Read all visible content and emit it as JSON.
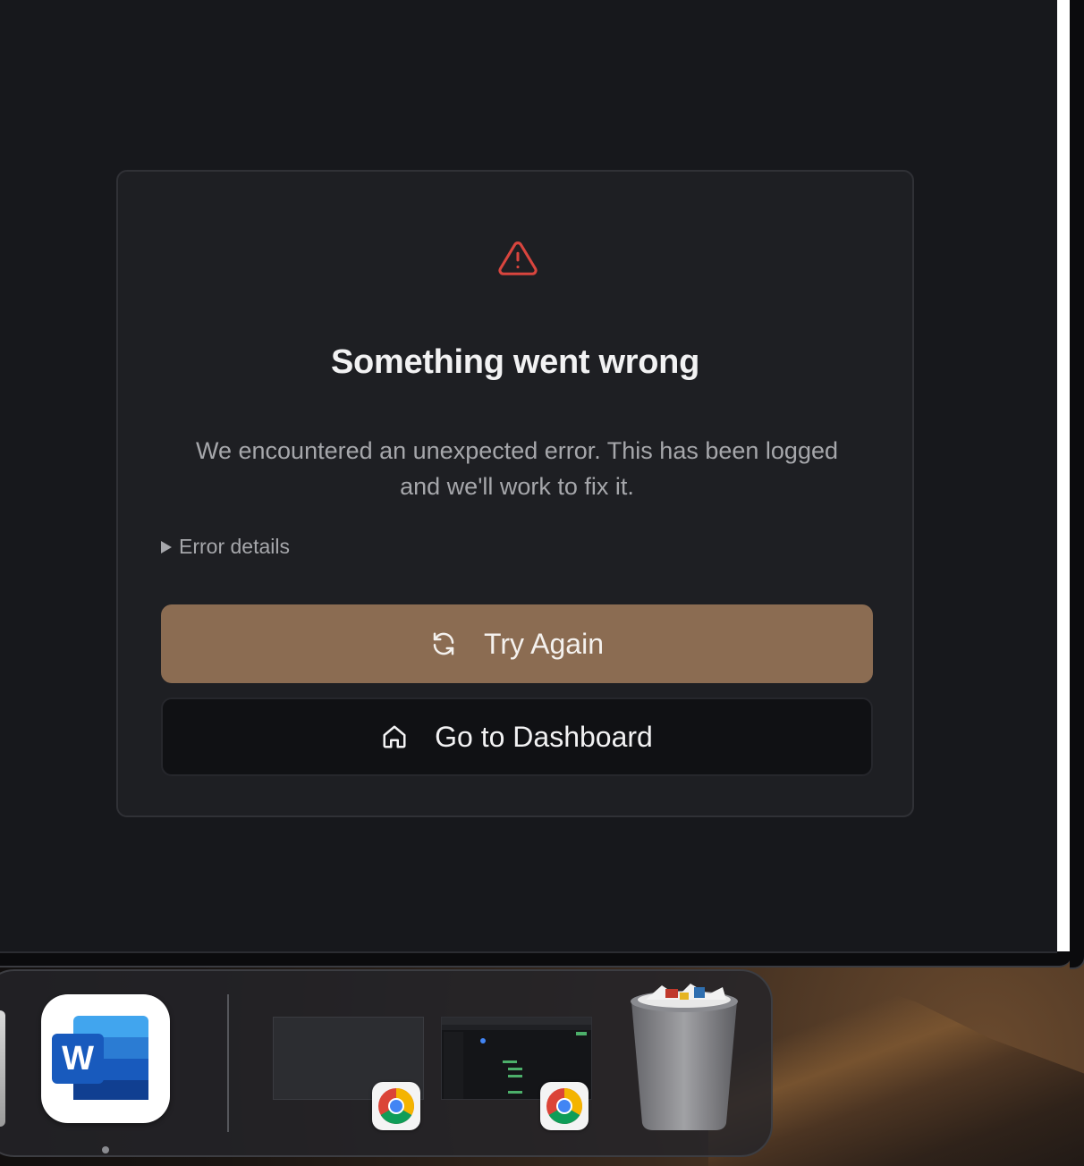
{
  "error_card": {
    "title": "Something went wrong",
    "message": "We encountered an unexpected error. This has been logged and we'll work to fix it.",
    "details_label": "Error details",
    "try_again_label": "Try Again",
    "dashboard_label": "Go to Dashboard",
    "icon": "warning-triangle-icon"
  },
  "colors": {
    "background": "#17181c",
    "card": "#1e1f23",
    "primary_button": "#8b6c52",
    "warning_icon": "#d9453e"
  },
  "dock": {
    "apps": [
      {
        "name": "Microsoft Word",
        "icon": "word-icon",
        "running": true
      },
      {
        "name": "Google Chrome window 1",
        "icon": "chrome-icon"
      },
      {
        "name": "Google Chrome window 2",
        "icon": "chrome-icon"
      },
      {
        "name": "Trash",
        "icon": "trash-icon"
      }
    ]
  }
}
